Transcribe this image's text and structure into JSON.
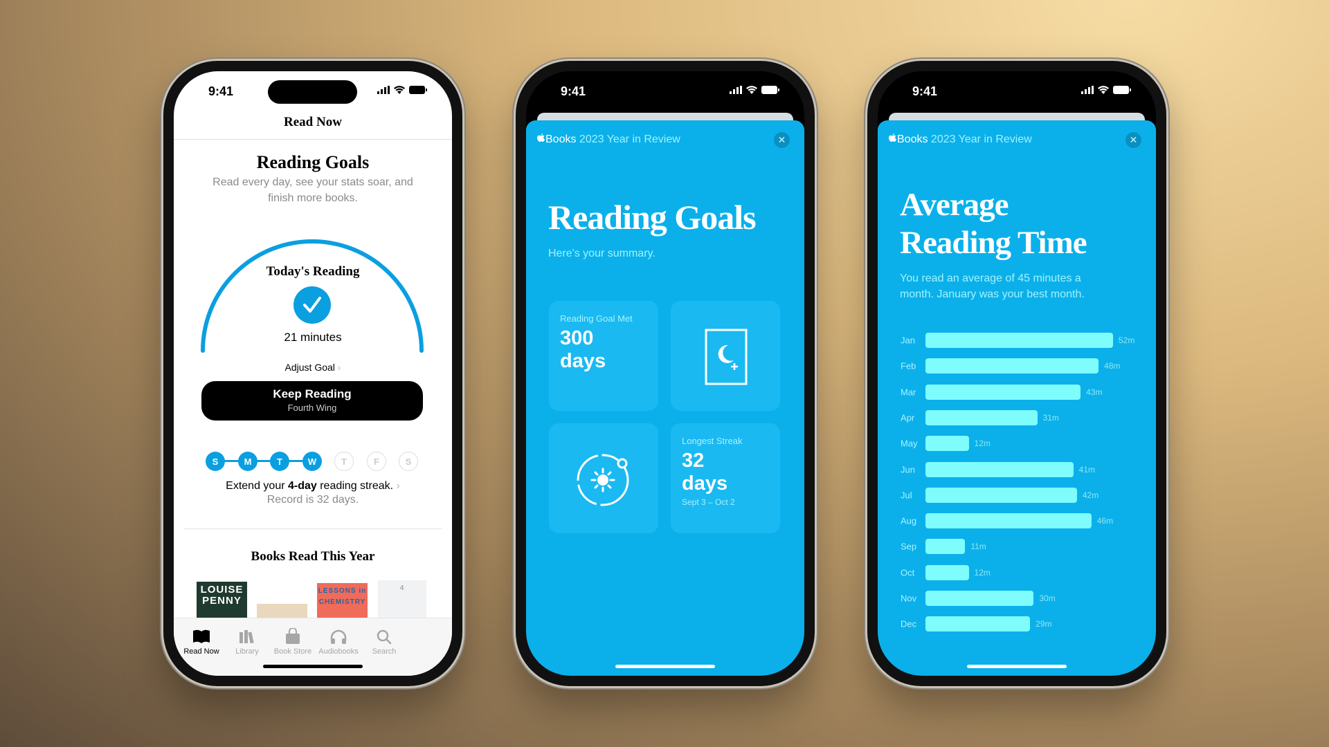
{
  "status": {
    "time": "9:41"
  },
  "phone1": {
    "nav_title": "Read Now",
    "section_title": "Reading Goals",
    "section_subtitle_1": "Read every day, see your stats soar, and",
    "section_subtitle_2": "finish more books.",
    "todays_reading": "Today's Reading",
    "minutes": "21 minutes",
    "goal_progress": 1.0,
    "adjust_goal": "Adjust Goal",
    "keep_reading": {
      "label": "Keep Reading",
      "book": "Fourth Wing"
    },
    "days": [
      {
        "letter": "S",
        "done": true
      },
      {
        "letter": "M",
        "done": true
      },
      {
        "letter": "T",
        "done": true
      },
      {
        "letter": "W",
        "done": true
      },
      {
        "letter": "T",
        "done": false
      },
      {
        "letter": "F",
        "done": false
      },
      {
        "letter": "S",
        "done": false
      }
    ],
    "streak_pre": "Extend your ",
    "streak_bold": "4-day",
    "streak_post": " reading streak.",
    "record": "Record is 32 days.",
    "books_title": "Books Read This Year",
    "books": [
      {
        "cover_text": "LOUISE PENNY",
        "color": "#1f3a2e"
      },
      {
        "cover_text": "",
        "color": "#e9d8bd"
      },
      {
        "cover_text": "LESSONS in CHEMISTRY",
        "color": "#ef6b5a"
      },
      {
        "cover_text": "4",
        "color": "#f1f2f4"
      }
    ],
    "tabs": [
      {
        "label": "Read Now",
        "icon": "book-open-icon",
        "active": true
      },
      {
        "label": "Library",
        "icon": "library-icon",
        "active": false
      },
      {
        "label": "Book Store",
        "icon": "shopping-bag-icon",
        "active": false
      },
      {
        "label": "Audiobooks",
        "icon": "headphones-icon",
        "active": false
      },
      {
        "label": "Search",
        "icon": "search-icon",
        "active": false
      }
    ]
  },
  "review": {
    "brand": "Books",
    "header": "2023 Year in Review",
    "close": "✕"
  },
  "phone2": {
    "title": "Reading Goals",
    "subtitle": "Here's your summary.",
    "goal_met": {
      "label": "Reading Goal Met",
      "value": "300",
      "unit": "days"
    },
    "streak": {
      "label": "Longest Streak",
      "value": "32",
      "unit": "days",
      "range": "Sept 3 – Oct 2"
    }
  },
  "phone3": {
    "title_1": "Average",
    "title_2": "Reading Time",
    "desc_1": "You read an average of 45 minutes a",
    "desc_2": "month. January was your best month."
  },
  "colors": {
    "accent": "#0a9fe0",
    "review_bg": "#0bb0ea",
    "bar": "#7ffdfd"
  },
  "chart_data": {
    "type": "bar",
    "orientation": "horizontal",
    "categories": [
      "Jan",
      "Feb",
      "Mar",
      "Apr",
      "May",
      "Jun",
      "Jul",
      "Aug",
      "Sep",
      "Oct",
      "Nov",
      "Dec"
    ],
    "values": [
      52,
      48,
      43,
      31,
      12,
      41,
      42,
      46,
      11,
      12,
      30,
      29
    ],
    "data_labels": [
      "52m",
      "48m",
      "43m",
      "31m",
      "12m",
      "41m",
      "42m",
      "46m",
      "11m",
      "12m",
      "30m",
      "29m"
    ],
    "unit": "minutes"
  }
}
